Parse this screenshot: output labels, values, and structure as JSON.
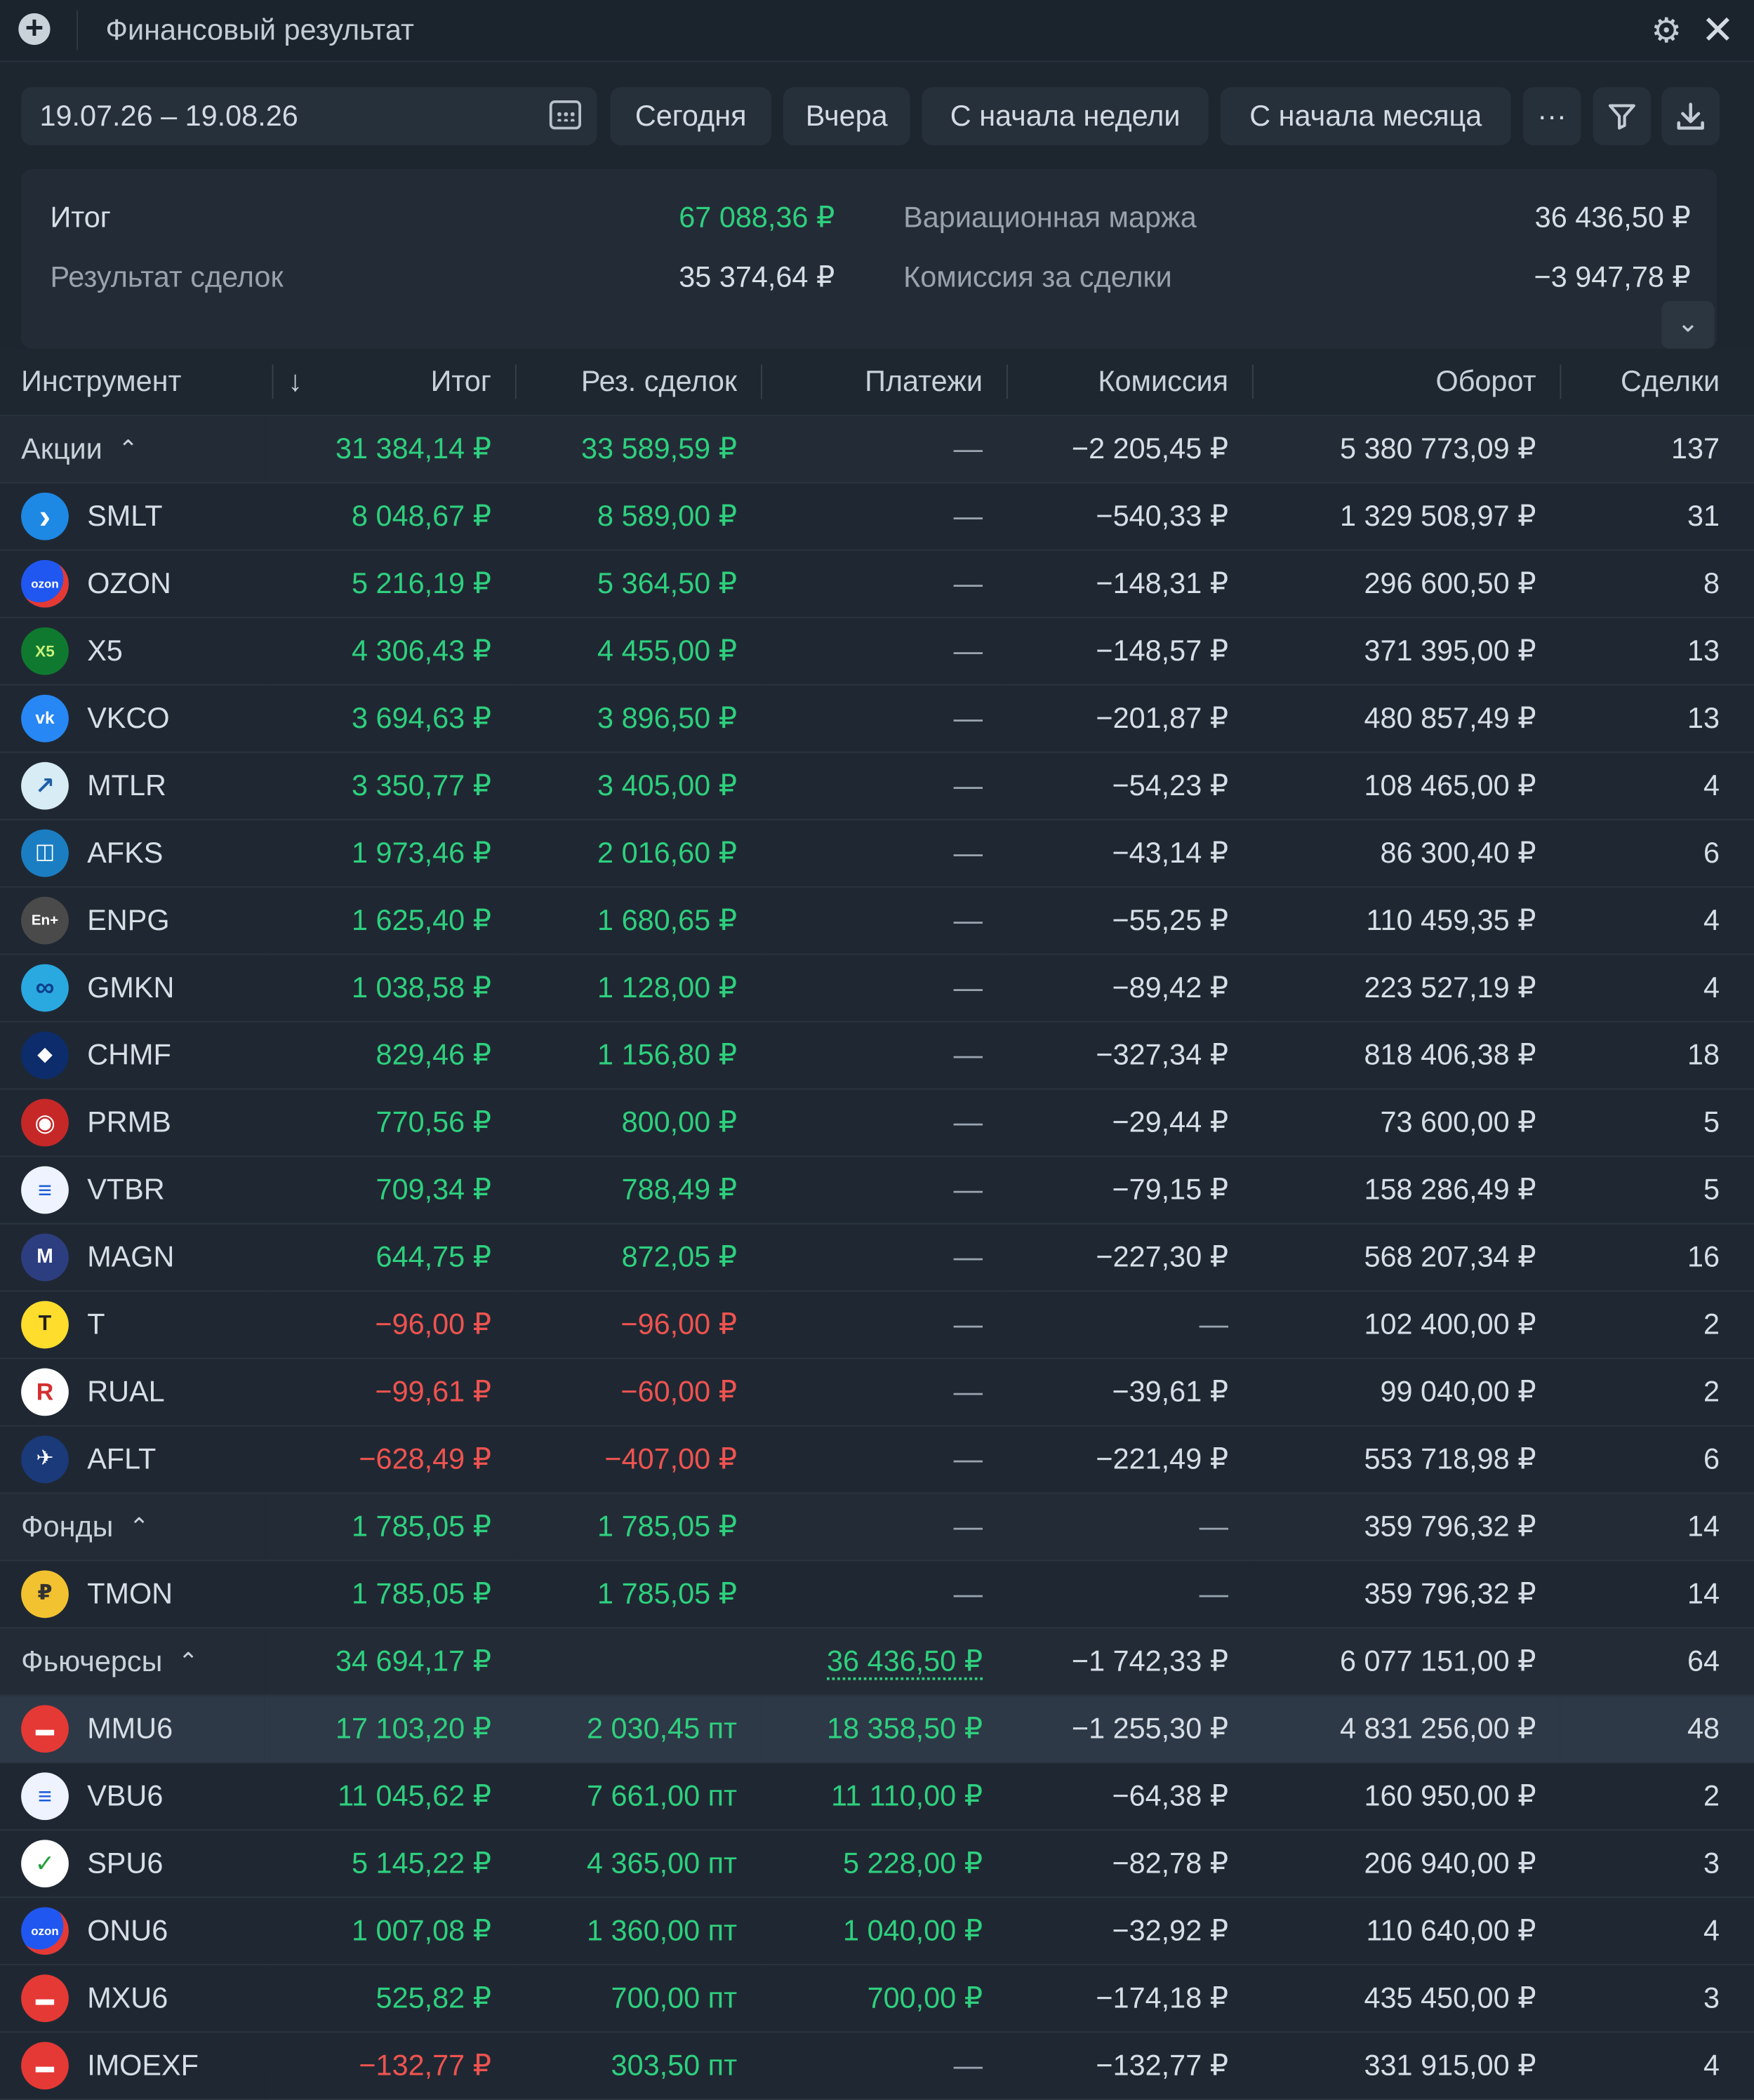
{
  "window": {
    "title": "Финансовый результат"
  },
  "toolbar": {
    "date_range": "19.07.26 – 19.08.26",
    "buttons": [
      "Сегодня",
      "Вчера",
      "С начала недели",
      "С начала месяца"
    ],
    "more_label": "···"
  },
  "summary": {
    "total_label": "Итог",
    "total_value": "67 088,36 ₽",
    "trades_label": "Результат сделок",
    "trades_value": "35 374,64 ₽",
    "margin_label": "Вариационная маржа",
    "margin_value": "36 436,50 ₽",
    "commission_label": "Комиссия за сделки",
    "commission_value": "−3 947,78 ₽"
  },
  "table": {
    "headers": [
      "Инструмент",
      "Итог",
      "Рез. сделок",
      "Платежи",
      "Комиссия",
      "Оборот",
      "Сделки"
    ],
    "rows": [
      {
        "kind": "group",
        "name": "Акции",
        "total": "31 384,14 ₽",
        "res": "33 589,59 ₽",
        "pay": "—",
        "comm": "−2 205,45 ₽",
        "turnover": "5 380 773,09 ₽",
        "deals": "137"
      },
      {
        "kind": "item",
        "name": "SMLT",
        "logo": "smlt",
        "total": "8 048,67 ₽",
        "res": "8 589,00 ₽",
        "pay": "—",
        "comm": "−540,33 ₽",
        "turnover": "1 329 508,97 ₽",
        "deals": "31"
      },
      {
        "kind": "item",
        "name": "OZON",
        "logo": "ozon",
        "total": "5 216,19 ₽",
        "res": "5 364,50 ₽",
        "pay": "—",
        "comm": "−148,31 ₽",
        "turnover": "296 600,50 ₽",
        "deals": "8"
      },
      {
        "kind": "item",
        "name": "X5",
        "logo": "x5",
        "total": "4 306,43 ₽",
        "res": "4 455,00 ₽",
        "pay": "—",
        "comm": "−148,57 ₽",
        "turnover": "371 395,00 ₽",
        "deals": "13"
      },
      {
        "kind": "item",
        "name": "VKCO",
        "logo": "vk",
        "total": "3 694,63 ₽",
        "res": "3 896,50 ₽",
        "pay": "—",
        "comm": "−201,87 ₽",
        "turnover": "480 857,49 ₽",
        "deals": "13"
      },
      {
        "kind": "item",
        "name": "MTLR",
        "logo": "mtlr",
        "total": "3 350,77 ₽",
        "res": "3 405,00 ₽",
        "pay": "—",
        "comm": "−54,23 ₽",
        "turnover": "108 465,00 ₽",
        "deals": "4"
      },
      {
        "kind": "item",
        "name": "AFKS",
        "logo": "afks",
        "total": "1 973,46 ₽",
        "res": "2 016,60 ₽",
        "pay": "—",
        "comm": "−43,14 ₽",
        "turnover": "86 300,40 ₽",
        "deals": "6"
      },
      {
        "kind": "item",
        "name": "ENPG",
        "logo": "enpg",
        "total": "1 625,40 ₽",
        "res": "1 680,65 ₽",
        "pay": "—",
        "comm": "−55,25 ₽",
        "turnover": "110 459,35 ₽",
        "deals": "4"
      },
      {
        "kind": "item",
        "name": "GMKN",
        "logo": "gmkn",
        "total": "1 038,58 ₽",
        "res": "1 128,00 ₽",
        "pay": "—",
        "comm": "−89,42 ₽",
        "turnover": "223 527,19 ₽",
        "deals": "4"
      },
      {
        "kind": "item",
        "name": "CHMF",
        "logo": "chmf",
        "total": "829,46 ₽",
        "res": "1 156,80 ₽",
        "pay": "—",
        "comm": "−327,34 ₽",
        "turnover": "818 406,38 ₽",
        "deals": "18"
      },
      {
        "kind": "item",
        "name": "PRMB",
        "logo": "prmb",
        "total": "770,56 ₽",
        "res": "800,00 ₽",
        "pay": "—",
        "comm": "−29,44 ₽",
        "turnover": "73 600,00 ₽",
        "deals": "5"
      },
      {
        "kind": "item",
        "name": "VTBR",
        "logo": "vtb",
        "total": "709,34 ₽",
        "res": "788,49 ₽",
        "pay": "—",
        "comm": "−79,15 ₽",
        "turnover": "158 286,49 ₽",
        "deals": "5"
      },
      {
        "kind": "item",
        "name": "MAGN",
        "logo": "magn",
        "total": "644,75 ₽",
        "res": "872,05 ₽",
        "pay": "—",
        "comm": "−227,30 ₽",
        "turnover": "568 207,34 ₽",
        "deals": "16"
      },
      {
        "kind": "item",
        "name": "T",
        "logo": "t",
        "total": "−96,00 ₽",
        "res": "−96,00 ₽",
        "pay": "—",
        "comm": "—",
        "turnover": "102 400,00 ₽",
        "deals": "2"
      },
      {
        "kind": "item",
        "name": "RUAL",
        "logo": "rual",
        "total": "−99,61 ₽",
        "res": "−60,00 ₽",
        "pay": "—",
        "comm": "−39,61 ₽",
        "turnover": "99 040,00 ₽",
        "deals": "2"
      },
      {
        "kind": "item",
        "name": "AFLT",
        "logo": "aflt",
        "total": "−628,49 ₽",
        "res": "−407,00 ₽",
        "pay": "—",
        "comm": "−221,49 ₽",
        "turnover": "553 718,98 ₽",
        "deals": "6"
      },
      {
        "kind": "group",
        "name": "Фонды",
        "total": "1 785,05 ₽",
        "res": "1 785,05 ₽",
        "pay": "—",
        "comm": "—",
        "turnover": "359 796,32 ₽",
        "deals": "14"
      },
      {
        "kind": "item",
        "name": "TMON",
        "logo": "tmon",
        "total": "1 785,05 ₽",
        "res": "1 785,05 ₽",
        "pay": "—",
        "comm": "—",
        "turnover": "359 796,32 ₽",
        "deals": "14"
      },
      {
        "kind": "group",
        "name": "Фьючерсы",
        "total": "34 694,17 ₽",
        "res": "",
        "pay": "36 436,50 ₽",
        "comm": "−1 742,33 ₽",
        "turnover": "6 077 151,00 ₽",
        "deals": "64"
      },
      {
        "kind": "item",
        "name": "MMU6",
        "logo": "moex",
        "selected": true,
        "total": "17 103,20 ₽",
        "res": "2 030,45 пт",
        "pay": "18 358,50 ₽",
        "comm": "−1 255,30 ₽",
        "turnover": "4 831 256,00 ₽",
        "deals": "48"
      },
      {
        "kind": "item",
        "name": "VBU6",
        "logo": "vtb",
        "total": "11 045,62 ₽",
        "res": "7 661,00 пт",
        "pay": "11 110,00 ₽",
        "comm": "−64,38 ₽",
        "turnover": "160 950,00 ₽",
        "deals": "2"
      },
      {
        "kind": "item",
        "name": "SPU6",
        "logo": "sber",
        "total": "5 145,22 ₽",
        "res": "4 365,00 пт",
        "pay": "5 228,00 ₽",
        "comm": "−82,78 ₽",
        "turnover": "206 940,00 ₽",
        "deals": "3"
      },
      {
        "kind": "item",
        "name": "ONU6",
        "logo": "ozon",
        "total": "1 007,08 ₽",
        "res": "1 360,00 пт",
        "pay": "1 040,00 ₽",
        "comm": "−32,92 ₽",
        "turnover": "110 640,00 ₽",
        "deals": "4"
      },
      {
        "kind": "item",
        "name": "MXU6",
        "logo": "moex",
        "total": "525,82 ₽",
        "res": "700,00 пт",
        "pay": "700,00 ₽",
        "comm": "−174,18 ₽",
        "turnover": "435 450,00 ₽",
        "deals": "3"
      },
      {
        "kind": "item",
        "name": "IMOEXF",
        "logo": "moex",
        "total": "−132,77 ₽",
        "res": "303,50 пт",
        "pay": "—",
        "comm": "−132,77 ₽",
        "turnover": "331 915,00 ₽",
        "deals": "4"
      }
    ]
  },
  "colors": {
    "positive": "#2ed07e",
    "negative": "#ef5350",
    "background": "#1d252f"
  }
}
